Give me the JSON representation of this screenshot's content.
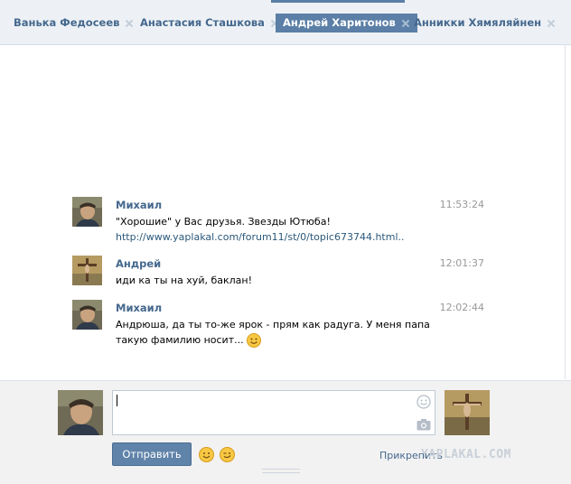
{
  "tabs": [
    {
      "label": "Ванька Федосеев",
      "active": false
    },
    {
      "label": "Анастасия Сташкова",
      "active": false
    },
    {
      "label": "Андрей Харитонов",
      "active": true
    },
    {
      "label": "Анникки Хямяляйнен",
      "active": false
    }
  ],
  "messages": [
    {
      "author": "Михаил",
      "time": "11:53:24",
      "text": "\"Хорошие\" у Вас друзья. Звезды Ютюба!",
      "link": "http://www.yaplakal.com/forum11/st/0/topic673744.html.."
    },
    {
      "author": "Андрей",
      "time": "12:01:37",
      "text": "иди ка ты на хуй, баклан!"
    },
    {
      "author": "Михаил",
      "time": "12:02:44",
      "text": "Андрюша, да ты то-же ярок - прям как радуга. У меня папа такую фамилию носит..."
    }
  ],
  "composer": {
    "input_value": "",
    "send_label": "Отправить",
    "attach_label": "Прикрепить"
  },
  "watermark": "YAPLAKAL.COM",
  "colors": {
    "accent": "#5b7fa6",
    "link": "#45688e",
    "tab_bg": "#edf1f5",
    "composer_bg": "#f2f2f2"
  }
}
